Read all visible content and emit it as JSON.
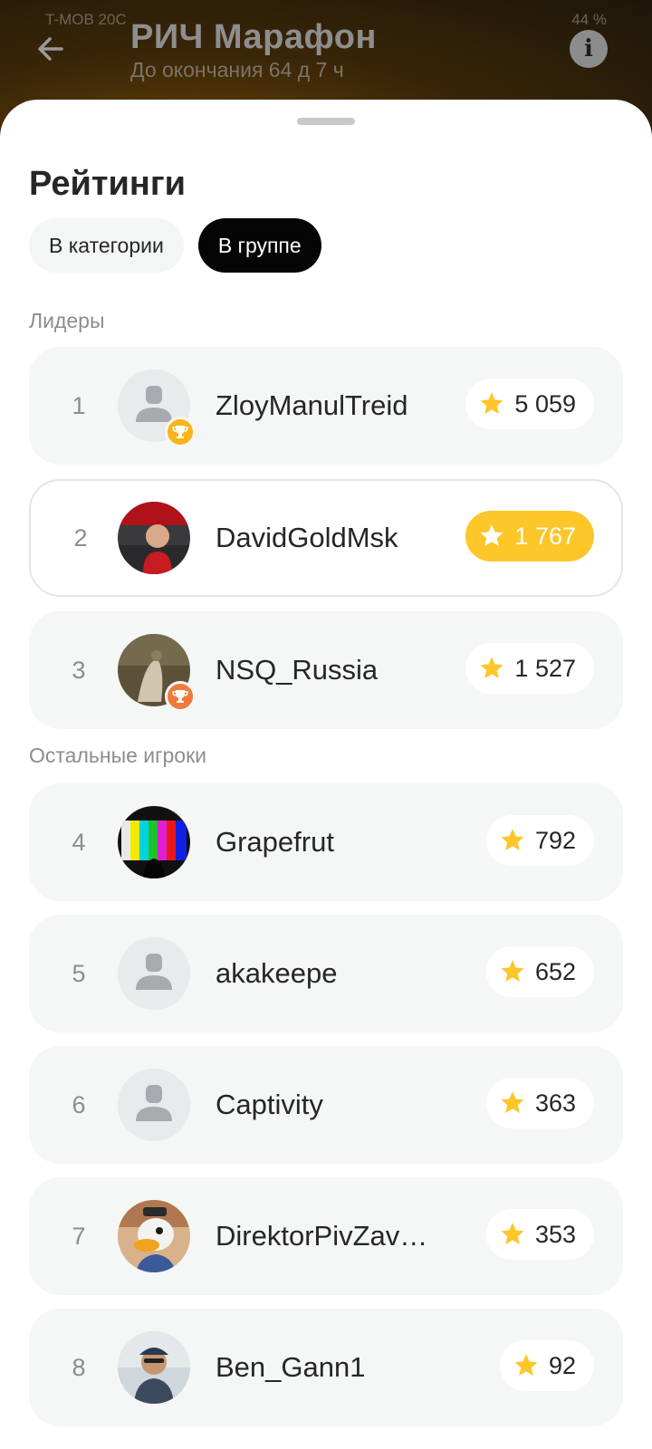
{
  "status_bar": {
    "carrier": "T-MOB 20C",
    "battery": "44 %"
  },
  "header": {
    "title": "РИЧ Марафон",
    "subtitle": "До окончания 64 д 7 ч"
  },
  "sheet": {
    "title": "Рейтинги",
    "tabs": [
      {
        "label": "В категории",
        "active": false
      },
      {
        "label": "В группе",
        "active": true
      }
    ],
    "leaders_label": "Лидеры",
    "others_label": "Остальные игроки"
  },
  "leaders": [
    {
      "rank": "1",
      "name": "ZloyManulTreid",
      "score": "5 059",
      "avatar": "default-avatar",
      "trophy": "gold-trophy"
    },
    {
      "rank": "2",
      "name": "DavidGoldMsk",
      "score": "1 767",
      "avatar": "photo-avatar",
      "current_user": true
    },
    {
      "rank": "3",
      "name": "NSQ_Russia",
      "score": "1 527",
      "avatar": "painting-avatar",
      "trophy": "bronze-trophy"
    }
  ],
  "others": [
    {
      "rank": "4",
      "name": "Grapefrut",
      "score": "792",
      "avatar": "tv-test-pattern-avatar"
    },
    {
      "rank": "5",
      "name": "akakeepe",
      "score": "652",
      "avatar": "default-avatar"
    },
    {
      "rank": "6",
      "name": "Captivity",
      "score": "363",
      "avatar": "default-avatar"
    },
    {
      "rank": "7",
      "name": "DirektorPivZav…",
      "score": "353",
      "avatar": "duck-avatar"
    },
    {
      "rank": "8",
      "name": "Ben_Gann1",
      "score": "92",
      "avatar": "photo-avatar"
    }
  ],
  "colors": {
    "accent": "#fdc629",
    "gold_trophy": "#f7b51a",
    "bronze_trophy": "#ee7a3c",
    "active_tab": "#050505"
  }
}
